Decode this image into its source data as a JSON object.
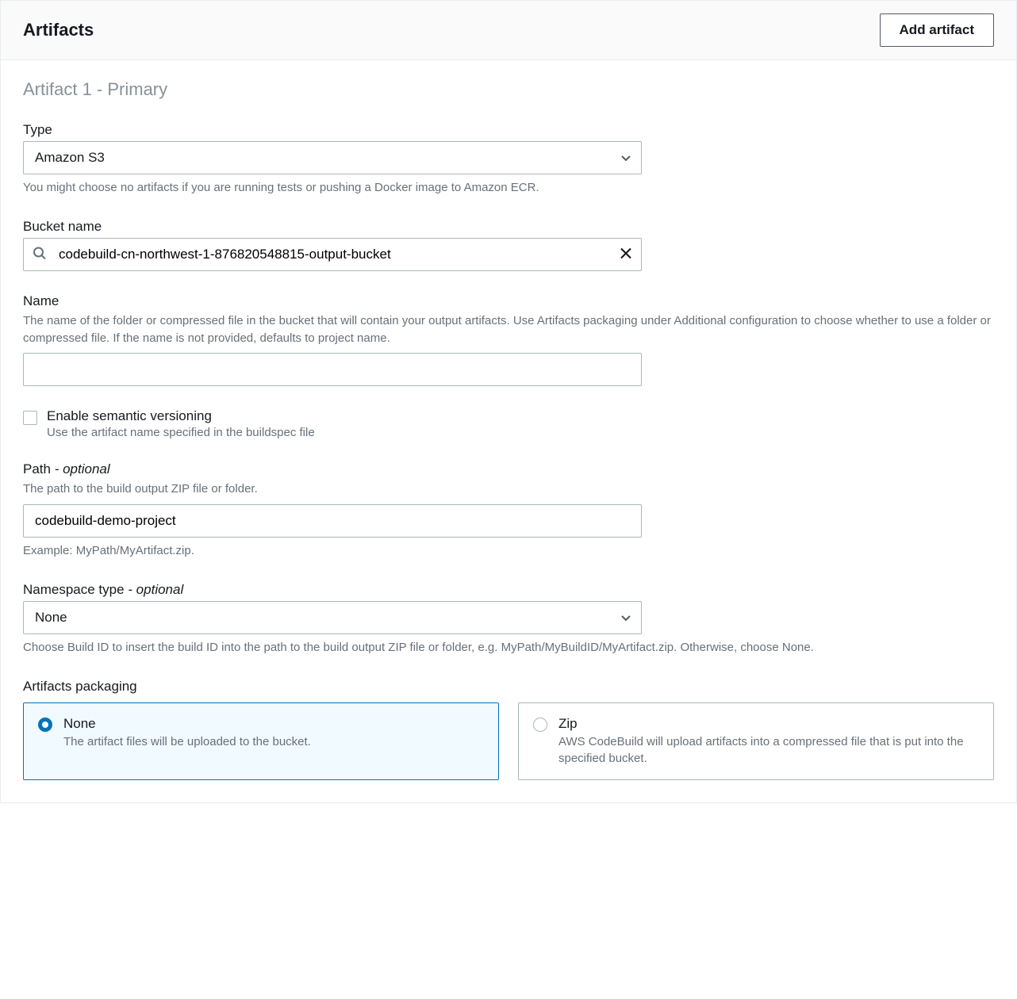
{
  "header": {
    "title": "Artifacts",
    "add_button": "Add artifact"
  },
  "section": {
    "title": "Artifact 1 - Primary"
  },
  "type": {
    "label": "Type",
    "value": "Amazon S3",
    "help": "You might choose no artifacts if you are running tests or pushing a Docker image to Amazon ECR."
  },
  "bucket": {
    "label": "Bucket name",
    "value": "codebuild-cn-northwest-1-876820548815-output-bucket"
  },
  "name": {
    "label": "Name",
    "description": "The name of the folder or compressed file in the bucket that will contain your output artifacts. Use Artifacts packaging under Additional configuration to choose whether to use a folder or compressed file. If the name is not provided, defaults to project name.",
    "value": ""
  },
  "semver": {
    "label": "Enable semantic versioning",
    "description": "Use the artifact name specified in the buildspec file"
  },
  "path": {
    "label": "Path",
    "optional": " - optional",
    "description": "The path to the build output ZIP file or folder.",
    "value": "codebuild-demo-project",
    "example": "Example: MyPath/MyArtifact.zip."
  },
  "namespace": {
    "label": "Namespace type",
    "optional": " - optional",
    "value": "None",
    "help": "Choose Build ID to insert the build ID into the path to the build output ZIP file or folder, e.g. MyPath/MyBuildID/MyArtifact.zip. Otherwise, choose None."
  },
  "packaging": {
    "label": "Artifacts packaging",
    "none": {
      "label": "None",
      "description": "The artifact files will be uploaded to the bucket."
    },
    "zip": {
      "label": "Zip",
      "description": "AWS CodeBuild will upload artifacts into a compressed file that is put into the specified bucket."
    }
  }
}
